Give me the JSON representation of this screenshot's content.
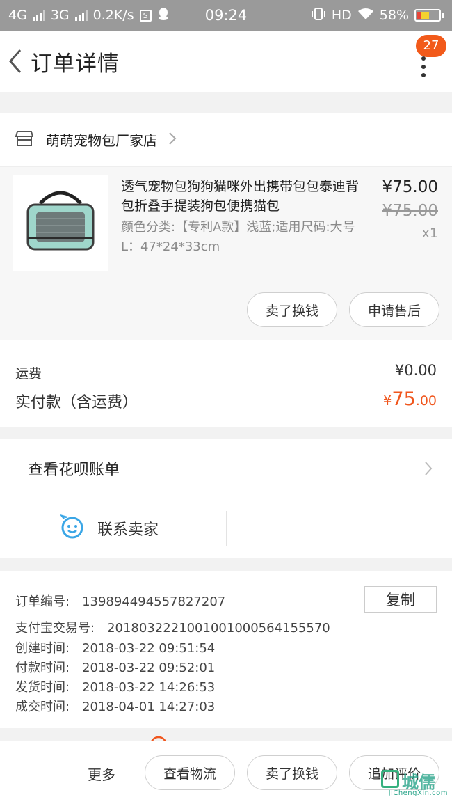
{
  "status_bar": {
    "network1": "4G",
    "network2": "3G",
    "speed": "0.2K/s",
    "s_icon_letter": "S",
    "time": "09:24",
    "hd": "HD",
    "battery": "58%"
  },
  "nav": {
    "title": "订单详情",
    "badge_count": "27"
  },
  "shop": {
    "name": "萌萌宠物包厂家店"
  },
  "product": {
    "title": "透气宠物包狗狗猫咪外出携带包包泰迪背包折叠手提装狗包便携猫包",
    "spec": "颜色分类:【专利A款】浅蓝;适用尺码:大号L：47*24*33cm",
    "price": "¥75.00",
    "original_price": "¥75.00",
    "quantity": "x1",
    "sell_button": "卖了换钱",
    "after_sale_button": "申请售后"
  },
  "totals": {
    "shipping_label": "运费",
    "shipping_value": "¥0.00",
    "paid_label": "实付款（含运费）",
    "paid_currency": "¥",
    "paid_int": "75",
    "paid_dec": ".00"
  },
  "huabei": {
    "label": "查看花呗账单"
  },
  "contact": {
    "label": "联系卖家"
  },
  "order_info": {
    "copy_button": "复制",
    "rows": [
      {
        "key": "订单编号:",
        "value": "139894494557827207"
      },
      {
        "key": "支付宝交易号:",
        "value": "2018032221001001000564155570"
      },
      {
        "key": "创建时间:",
        "value": "2018-03-22 09:51:54"
      },
      {
        "key": "付款时间:",
        "value": "2018-03-22 09:52:01"
      },
      {
        "key": "发货时间:",
        "value": "2018-03-22 14:26:53"
      },
      {
        "key": "成交时间:",
        "value": "2018-04-01 14:27:03"
      }
    ]
  },
  "bottom_bar": {
    "more": "更多",
    "logistics": "查看物流",
    "sell": "卖了换钱",
    "add_review": "追加评价"
  },
  "watermark": {
    "zh": "城儒",
    "en": "JiChengXin.com"
  },
  "colors": {
    "accent": "#f0561d",
    "badge": "#f25a1a",
    "contact_icon": "#3aa6e6"
  }
}
